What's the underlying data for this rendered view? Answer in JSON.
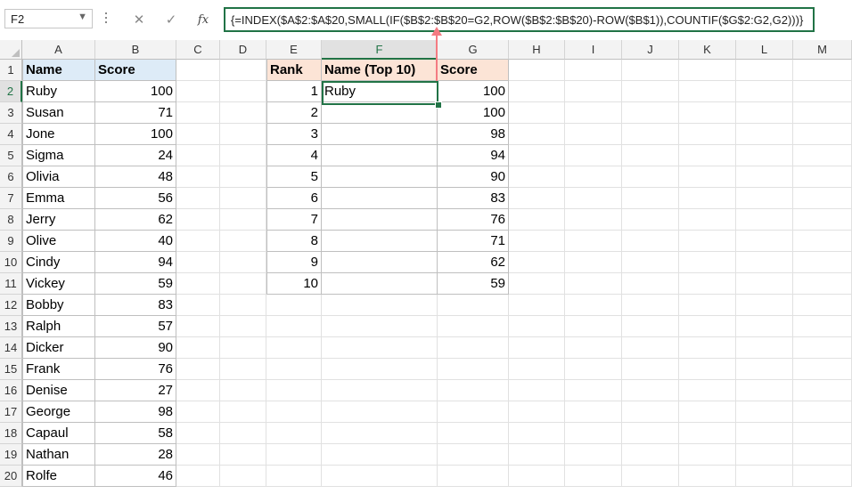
{
  "formula_bar": {
    "name_box": "F2",
    "cancel_icon": "close-icon",
    "enter_icon": "check-icon",
    "fx_label": "fx",
    "formula": "{=INDEX($A$2:$A$20,SMALL(IF($B$2:$B$20=G2,ROW($B$2:$B$20)-ROW($B$1)),COUNTIF($G$2:G2,G2)))}"
  },
  "columns": [
    "A",
    "B",
    "C",
    "D",
    "E",
    "F",
    "G",
    "H",
    "I",
    "J",
    "K",
    "L",
    "M"
  ],
  "active_column": "F",
  "active_row": "2",
  "rows": [
    "1",
    "2",
    "3",
    "4",
    "5",
    "6",
    "7",
    "8",
    "9",
    "10",
    "11",
    "12",
    "13",
    "14",
    "15",
    "16",
    "17",
    "18",
    "19",
    "20"
  ],
  "source_table": {
    "headers": {
      "name": "Name",
      "score": "Score"
    },
    "data": [
      {
        "name": "Ruby",
        "score": "100"
      },
      {
        "name": "Susan",
        "score": "71"
      },
      {
        "name": "Jone",
        "score": "100"
      },
      {
        "name": "Sigma",
        "score": "24"
      },
      {
        "name": "Olivia",
        "score": "48"
      },
      {
        "name": "Emma",
        "score": "56"
      },
      {
        "name": "Jerry",
        "score": "62"
      },
      {
        "name": "Olive",
        "score": "40"
      },
      {
        "name": "Cindy",
        "score": "94"
      },
      {
        "name": "Vickey",
        "score": "59"
      },
      {
        "name": "Bobby",
        "score": "83"
      },
      {
        "name": "Ralph",
        "score": "57"
      },
      {
        "name": "Dicker",
        "score": "90"
      },
      {
        "name": "Frank",
        "score": "76"
      },
      {
        "name": "Denise",
        "score": "27"
      },
      {
        "name": "George",
        "score": "98"
      },
      {
        "name": "Capaul",
        "score": "58"
      },
      {
        "name": "Nathan",
        "score": "28"
      },
      {
        "name": "Rolfe",
        "score": "46"
      }
    ]
  },
  "result_table": {
    "headers": {
      "rank": "Rank",
      "name": "Name (Top 10)",
      "score": "Score"
    },
    "data": [
      {
        "rank": "1",
        "name": "Ruby",
        "score": "100"
      },
      {
        "rank": "2",
        "name": "",
        "score": "100"
      },
      {
        "rank": "3",
        "name": "",
        "score": "98"
      },
      {
        "rank": "4",
        "name": "",
        "score": "94"
      },
      {
        "rank": "5",
        "name": "",
        "score": "90"
      },
      {
        "rank": "6",
        "name": "",
        "score": "83"
      },
      {
        "rank": "7",
        "name": "",
        "score": "76"
      },
      {
        "rank": "8",
        "name": "",
        "score": "71"
      },
      {
        "rank": "9",
        "name": "",
        "score": "62"
      },
      {
        "rank": "10",
        "name": "",
        "score": "59"
      }
    ]
  },
  "colors": {
    "accent": "#217346",
    "name_header_fill": "#ddebf7",
    "result_header_fill": "#fce4d6",
    "pointer_arrow": "#f47b82"
  }
}
